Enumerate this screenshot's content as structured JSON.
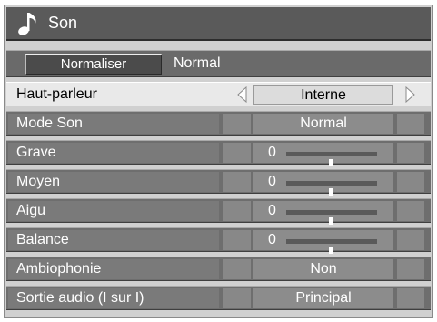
{
  "title": "Son",
  "normaliser": {
    "button_label": "Normaliser",
    "value": "Normal"
  },
  "settings": [
    {
      "label": "Haut-parleur",
      "value": "Interne"
    },
    {
      "label": "Mode Son",
      "value": "Normal"
    },
    {
      "label": "Grave",
      "value": "0",
      "level": 0
    },
    {
      "label": "Moyen",
      "value": "0",
      "level": 0
    },
    {
      "label": "Aigu",
      "value": "0",
      "level": 0
    },
    {
      "label": "Balance",
      "value": "0",
      "level": 0
    },
    {
      "label": "Ambiophonie",
      "value": "Non"
    },
    {
      "label": "Sortie audio (I sur I)",
      "value": "Principal"
    }
  ],
  "icons": {
    "title": "music-note-icon",
    "previous": "arrow-left-icon",
    "next": "arrow-right-icon"
  },
  "colors": {
    "title_bar": "#5a5a5a",
    "row": "#6e6e6e",
    "selected_row": "#e9e9e9"
  }
}
